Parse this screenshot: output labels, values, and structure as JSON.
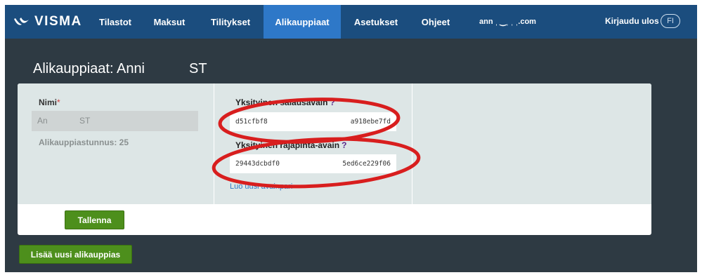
{
  "brand": {
    "logo_text": "VISMA"
  },
  "nav": {
    "items": [
      {
        "label": "Tilastot",
        "active": false
      },
      {
        "label": "Maksut",
        "active": false
      },
      {
        "label": "Tilitykset",
        "active": false
      },
      {
        "label": "Alikauppiaat",
        "active": true
      },
      {
        "label": "Asetukset",
        "active": false
      },
      {
        "label": "Ohjeet",
        "active": false
      }
    ],
    "user_email": "ann  ˌ   ‿ˌ  ˌ  ˌ.com",
    "logout_label": "Kirjaudu ulos",
    "language": "FI"
  },
  "page": {
    "title": "Alikauppiaat: Anni",
    "title_tail": "ST"
  },
  "form": {
    "name_label": "Nimi",
    "required_mark": "*",
    "name_value": "An",
    "name_value_tail": "ST",
    "subaccount_id": "Alikauppiastunnus: 25",
    "private_key_title": "Yksityinen salausavain",
    "private_key_help": "?",
    "private_key_start": "d51cfbf8",
    "private_key_end": "a918ebe7fd",
    "api_key_title": "Yksityinen rajapinta-avain",
    "api_key_help": "?",
    "api_key_start": "29443dcbdf0",
    "api_key_end": "5ed6ce229f06",
    "new_keypair_link": "Luo uusi avainpari",
    "save_button": "Tallenna"
  },
  "actions": {
    "add_subaccount_button": "Lisää uusi alikauppias"
  },
  "colors": {
    "nav_bg": "#1b4d7e",
    "nav_active": "#2e78c8",
    "page_bg": "#2e3a43",
    "panel_bg": "#dde6e6",
    "button_green": "#4d8f1c",
    "annotation_red": "#d81e1e"
  }
}
